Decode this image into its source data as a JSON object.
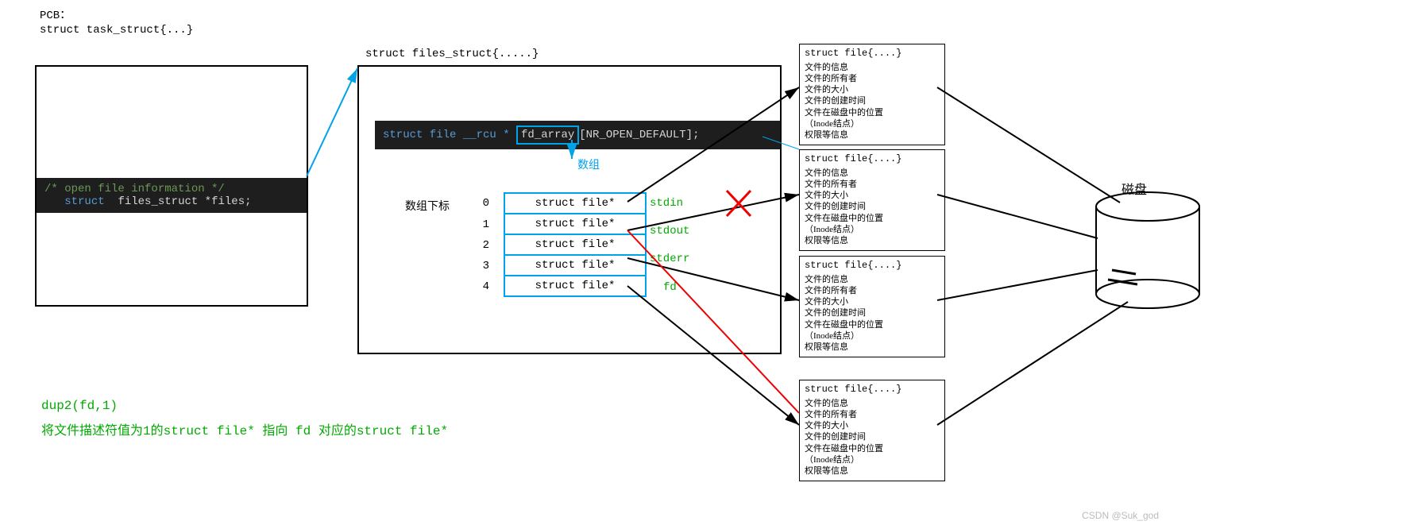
{
  "header": {
    "pcb_label": "PCB：",
    "task_struct": "struct task_struct{...}"
  },
  "pcb_box": {
    "comment": "/* open file information */",
    "decl_kw": "struct",
    "decl_type": "files_struct",
    "decl_rest": " *files;"
  },
  "files_struct": {
    "title": "struct files_struct{.....}",
    "fd_array_prefix": "struct file __rcu * ",
    "fd_array_mid": "fd_array",
    "fd_array_suffix": "[NR_OPEN_DEFAULT];",
    "array_label": "数组",
    "index_label": "数组下标",
    "rows": [
      {
        "idx": "0",
        "cell": "struct file*",
        "tag": "stdin"
      },
      {
        "idx": "1",
        "cell": "struct file*",
        "tag": "stdout"
      },
      {
        "idx": "2",
        "cell": "struct file*",
        "tag": "stderr"
      },
      {
        "idx": "3",
        "cell": "struct file*",
        "tag": "fd"
      },
      {
        "idx": "4",
        "cell": "struct file*",
        "tag": ""
      }
    ]
  },
  "file_struct": {
    "title": "struct file{....}",
    "l1": "文件的信息",
    "l2": "文件的所有者",
    "l3": "文件的大小",
    "l4": "文件的创建时间",
    "l5": "文件在磁盘中的位置",
    "l6": "（Inode结点）",
    "l7": "权限等信息"
  },
  "disk": {
    "label": "磁盘"
  },
  "footer": {
    "dup": "dup2(fd,1)",
    "desc": "将文件描述符值为1的struct file* 指向 fd 对应的struct file*"
  },
  "watermark": "CSDN @Suk_god"
}
